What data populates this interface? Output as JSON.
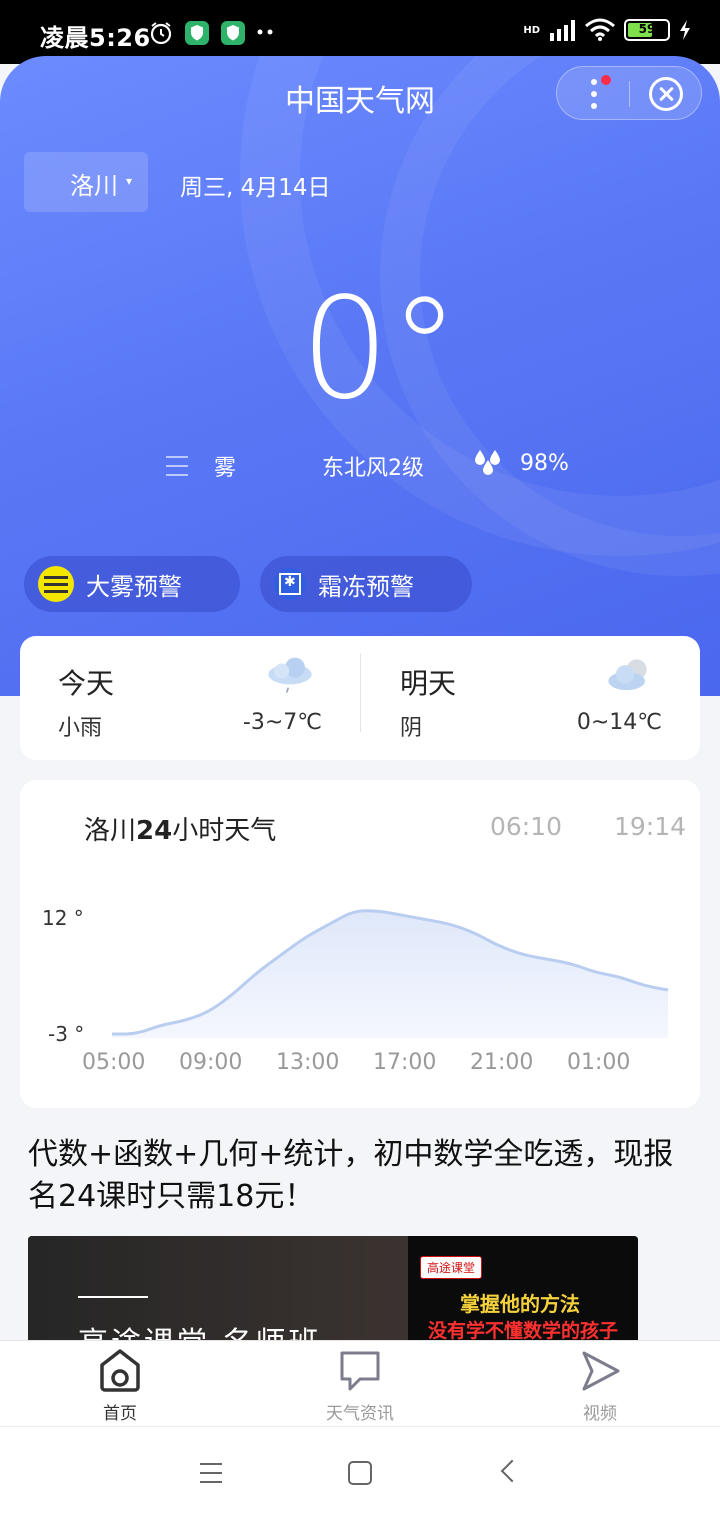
{
  "status_bar": {
    "time": "凌晨5:26",
    "network": "HD",
    "battery": "59"
  },
  "header": {
    "app_title": "中国天气网",
    "city": "洛川",
    "city_caret": "▾",
    "date": "周三, 4月14日"
  },
  "current": {
    "temperature": "0°",
    "condition": "雾",
    "wind": "东北风2级",
    "humidity": "98%"
  },
  "alerts": [
    {
      "label": "大雾预警",
      "color": "#f5e600"
    },
    {
      "label": "霜冻预警",
      "color": "#2f5fe0"
    }
  ],
  "forecast": {
    "today": {
      "day": "今天",
      "desc": "小雨",
      "range": "-3~7℃"
    },
    "tomorrow": {
      "day": "明天",
      "desc": "阴",
      "range": "0~14℃"
    }
  },
  "hourly": {
    "title_city": "洛川",
    "title_hours": "24",
    "title_suffix": "小时天气",
    "sunrise": "06:10",
    "sunset": "19:14"
  },
  "chart_data": {
    "type": "area",
    "title": "",
    "x_tick_labels": [
      "05:00",
      "09:00",
      "13:00",
      "17:00",
      "21:00",
      "01:00"
    ],
    "y_tick_labels": [
      "12 °",
      "-3 °"
    ],
    "ylim": [
      -3,
      12
    ],
    "x": [
      "05:00",
      "06:00",
      "07:00",
      "08:00",
      "09:00",
      "10:00",
      "11:00",
      "12:00",
      "13:00",
      "14:00",
      "15:00",
      "16:00",
      "17:00",
      "18:00",
      "19:00",
      "20:00",
      "21:00",
      "22:00",
      "23:00",
      "00:00",
      "01:00",
      "02:00",
      "03:00",
      "04:00"
    ],
    "values": [
      -3,
      -3,
      -2,
      -1.5,
      -0.5,
      1.5,
      4,
      6,
      8,
      9.5,
      11,
      11,
      10.5,
      10,
      9.5,
      8.5,
      7,
      6,
      5.5,
      5,
      4,
      3.5,
      2.5,
      2
    ],
    "line_color": "#b9cdf0",
    "fill_color": "#e3ebfb"
  },
  "ad": {
    "headline": "代数+函数+几何+统计，初中数学全吃透，现报名24课时只需18元！",
    "banner_title": "高途课堂  名师班",
    "brand_tag": "高途课堂",
    "slogan_1": "掌握他的方法",
    "slogan_2": "没有学不懂数学的孩子"
  },
  "tabbar": {
    "home": "首页",
    "news": "天气资讯",
    "video": "视频"
  }
}
